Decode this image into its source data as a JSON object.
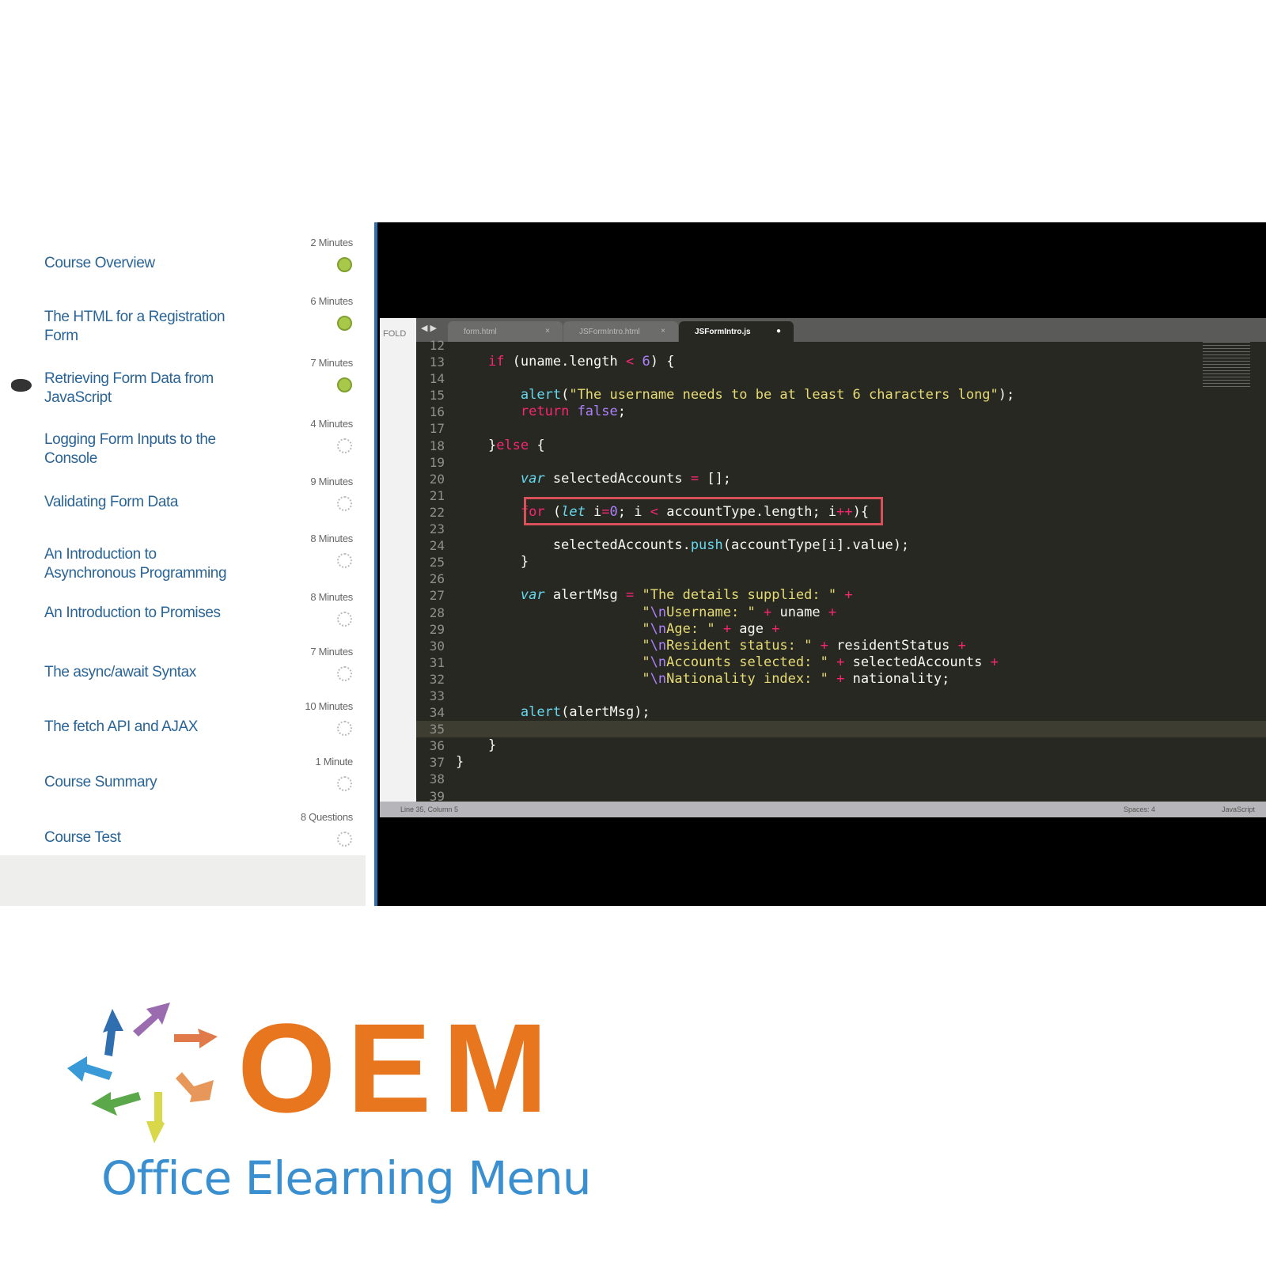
{
  "course_items": [
    {
      "title": "Course Overview",
      "duration": "2 Minutes",
      "status": "complete"
    },
    {
      "title": "The HTML for a Registration Form",
      "duration": "6 Minutes",
      "status": "complete"
    },
    {
      "title": "Retrieving Form Data from JavaScript",
      "duration": "7 Minutes",
      "status": "complete"
    },
    {
      "title": "Logging Form Inputs to the Console",
      "duration": "4 Minutes",
      "status": "incomplete"
    },
    {
      "title": "Validating Form Data",
      "duration": "9 Minutes",
      "status": "incomplete"
    },
    {
      "title": "An Introduction to Asynchronous Programming",
      "duration": "8 Minutes",
      "status": "incomplete"
    },
    {
      "title": "An Introduction to Promises",
      "duration": "8 Minutes",
      "status": "incomplete"
    },
    {
      "title": "The async/await Syntax",
      "duration": "7 Minutes",
      "status": "incomplete"
    },
    {
      "title": "The fetch API and AJAX",
      "duration": "10 Minutes",
      "status": "incomplete"
    },
    {
      "title": "Course Summary",
      "duration": "1 Minute",
      "status": "incomplete"
    },
    {
      "title": "Course Test",
      "duration": "8 Questions",
      "status": "incomplete"
    }
  ],
  "current_item": 2,
  "editor": {
    "folders_label": "FOLD",
    "tabs": [
      {
        "label": "form.html",
        "close": "×"
      },
      {
        "label": "JSFormIntro.html",
        "close": "×"
      },
      {
        "label": "JSFormIntro.js",
        "close": "●"
      }
    ],
    "status_left": "Line 35, Column 5",
    "status_spaces": "Spaces: 4",
    "status_lang": "JavaScript",
    "current_line": 35,
    "lines": [
      {
        "n": "12",
        "t": []
      },
      {
        "n": "13",
        "t": [
          [
            "    ",
            ""
          ],
          [
            "if",
            "k"
          ],
          [
            " (uname.length ",
            ""
          ],
          [
            "<",
            "o"
          ],
          [
            " ",
            ""
          ],
          [
            "6",
            "n"
          ],
          [
            ") {",
            ""
          ]
        ]
      },
      {
        "n": "14",
        "t": []
      },
      {
        "n": "15",
        "t": [
          [
            "        ",
            ""
          ],
          [
            "alert",
            "f"
          ],
          [
            "(",
            ""
          ],
          [
            "\"The username needs to be at least 6 characters long\"",
            "s"
          ],
          [
            ");",
            ""
          ]
        ]
      },
      {
        "n": "16",
        "t": [
          [
            "        ",
            ""
          ],
          [
            "return",
            "k"
          ],
          [
            " ",
            ""
          ],
          [
            "false",
            "n"
          ],
          [
            ";",
            ""
          ]
        ]
      },
      {
        "n": "17",
        "t": []
      },
      {
        "n": "18",
        "t": [
          [
            "    }",
            ""
          ],
          [
            "else",
            "k"
          ],
          [
            " {",
            ""
          ]
        ]
      },
      {
        "n": "19",
        "t": []
      },
      {
        "n": "20",
        "t": [
          [
            "        ",
            ""
          ],
          [
            "var",
            "i"
          ],
          [
            " selectedAccounts ",
            ""
          ],
          [
            "=",
            "o"
          ],
          [
            " [];",
            ""
          ]
        ]
      },
      {
        "n": "21",
        "t": []
      },
      {
        "n": "22",
        "t": [
          [
            "        ",
            ""
          ],
          [
            "for",
            "k"
          ],
          [
            " (",
            ""
          ],
          [
            "let",
            "i"
          ],
          [
            " i",
            ""
          ],
          [
            "=",
            "o"
          ],
          [
            "0",
            "n"
          ],
          [
            "; i ",
            ""
          ],
          [
            "<",
            "o"
          ],
          [
            " accountType.length; i",
            ""
          ],
          [
            "++",
            "o"
          ],
          [
            "){",
            ""
          ]
        ]
      },
      {
        "n": "23",
        "t": []
      },
      {
        "n": "24",
        "t": [
          [
            "            selectedAccounts.",
            ""
          ],
          [
            "push",
            "f"
          ],
          [
            "(accountType[i].value);",
            ""
          ]
        ]
      },
      {
        "n": "25",
        "t": [
          [
            "        }",
            ""
          ]
        ]
      },
      {
        "n": "26",
        "t": []
      },
      {
        "n": "27",
        "t": [
          [
            "        ",
            ""
          ],
          [
            "var",
            "i"
          ],
          [
            " alertMsg ",
            ""
          ],
          [
            "=",
            "o"
          ],
          [
            " ",
            ""
          ],
          [
            "\"The details supplied: \"",
            "s"
          ],
          [
            " ",
            ""
          ],
          [
            "+",
            "o"
          ]
        ]
      },
      {
        "n": "28",
        "t": [
          [
            "                       ",
            ""
          ],
          [
            "\"",
            "s"
          ],
          [
            "\\n",
            "n"
          ],
          [
            "Username: \"",
            "s"
          ],
          [
            " ",
            ""
          ],
          [
            "+",
            "o"
          ],
          [
            " uname ",
            ""
          ],
          [
            "+",
            "o"
          ]
        ]
      },
      {
        "n": "29",
        "t": [
          [
            "                       ",
            ""
          ],
          [
            "\"",
            "s"
          ],
          [
            "\\n",
            "n"
          ],
          [
            "Age: \"",
            "s"
          ],
          [
            " ",
            ""
          ],
          [
            "+",
            "o"
          ],
          [
            " age ",
            ""
          ],
          [
            "+",
            "o"
          ]
        ]
      },
      {
        "n": "30",
        "t": [
          [
            "                       ",
            ""
          ],
          [
            "\"",
            "s"
          ],
          [
            "\\n",
            "n"
          ],
          [
            "Resident status: \"",
            "s"
          ],
          [
            " ",
            ""
          ],
          [
            "+",
            "o"
          ],
          [
            " residentStatus ",
            ""
          ],
          [
            "+",
            "o"
          ]
        ]
      },
      {
        "n": "31",
        "t": [
          [
            "                       ",
            ""
          ],
          [
            "\"",
            "s"
          ],
          [
            "\\n",
            "n"
          ],
          [
            "Accounts selected: \"",
            "s"
          ],
          [
            " ",
            ""
          ],
          [
            "+",
            "o"
          ],
          [
            " selectedAccounts ",
            ""
          ],
          [
            "+",
            "o"
          ]
        ]
      },
      {
        "n": "32",
        "t": [
          [
            "                       ",
            ""
          ],
          [
            "\"",
            "s"
          ],
          [
            "\\n",
            "n"
          ],
          [
            "Nationality index: \"",
            "s"
          ],
          [
            " ",
            ""
          ],
          [
            "+",
            "o"
          ],
          [
            " nationality;",
            ""
          ]
        ]
      },
      {
        "n": "33",
        "t": []
      },
      {
        "n": "34",
        "t": [
          [
            "        ",
            ""
          ],
          [
            "alert",
            "f"
          ],
          [
            "(alertMsg);",
            ""
          ]
        ]
      },
      {
        "n": "35",
        "t": []
      },
      {
        "n": "36",
        "t": [
          [
            "    }",
            ""
          ]
        ]
      },
      {
        "n": "37",
        "t": [
          [
            "}",
            ""
          ]
        ]
      },
      {
        "n": "38",
        "t": []
      },
      {
        "n": "39",
        "t": []
      }
    ]
  },
  "logo": {
    "letters": "OEM",
    "tagline": "Office Elearning Menu",
    "colors": {
      "orange": "#e8761e",
      "blue": "#3a8fd0"
    }
  }
}
